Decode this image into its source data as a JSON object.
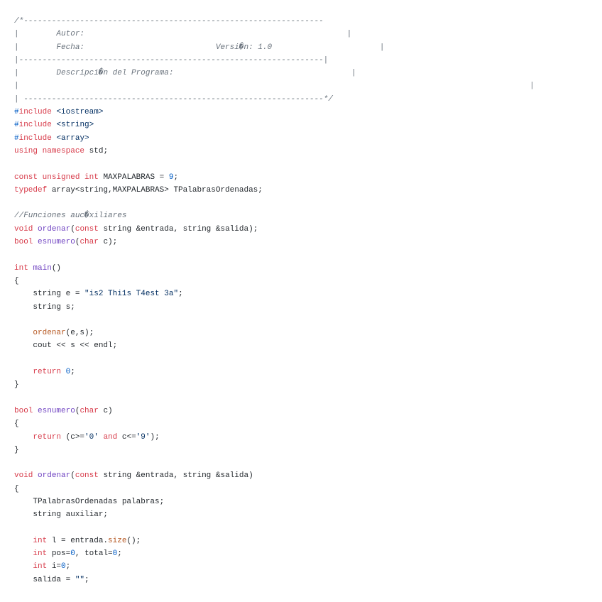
{
  "colors": {
    "keyword": "#d73a49",
    "function": "#6f42c1",
    "string": "#032f62",
    "number": "#005cc5",
    "comment": "#6a737d",
    "call": "#b5561f",
    "text": "#24292e"
  },
  "lines": [
    [
      [
        "/*----------------------------------------------------------------",
        "com"
      ]
    ],
    [
      [
        "|        Autor:                                                        |",
        "com"
      ]
    ],
    [
      [
        "|        Fecha:                            Versi�n: 1.0                       |",
        "com"
      ]
    ],
    [
      [
        "|-----------------------------------------------------------------|",
        "com"
      ]
    ],
    [
      [
        "|        Descripci�n del Programa:                                      |",
        "com"
      ]
    ],
    [
      [
        "|                                                                                                             |",
        "com"
      ]
    ],
    [
      [
        "| ----------------------------------------------------------------*/",
        "com"
      ]
    ],
    [
      [
        "#",
        "pp"
      ],
      [
        "include",
        "kw"
      ],
      [
        " ",
        "pl"
      ],
      [
        "<iostream>",
        "str"
      ]
    ],
    [
      [
        "#",
        "pp"
      ],
      [
        "include",
        "kw"
      ],
      [
        " ",
        "pl"
      ],
      [
        "<string>",
        "str"
      ]
    ],
    [
      [
        "#",
        "pp"
      ],
      [
        "include",
        "kw"
      ],
      [
        " ",
        "pl"
      ],
      [
        "<array>",
        "str"
      ]
    ],
    [
      [
        "using",
        "kw"
      ],
      [
        " ",
        "pl"
      ],
      [
        "namespace",
        "kw"
      ],
      [
        " std;",
        "pl"
      ]
    ],
    [],
    [
      [
        "const",
        "kw"
      ],
      [
        " ",
        "pl"
      ],
      [
        "unsigned",
        "kw"
      ],
      [
        " ",
        "pl"
      ],
      [
        "int",
        "kw"
      ],
      [
        " MAXPALABRAS = ",
        "pl"
      ],
      [
        "9",
        "num"
      ],
      [
        ";",
        "pl"
      ]
    ],
    [
      [
        "typedef",
        "kw"
      ],
      [
        " array<string,MAXPALABRAS> TPalabrasOrdenadas;",
        "pl"
      ]
    ],
    [],
    [
      [
        "//Funciones auc�xiliares",
        "com"
      ]
    ],
    [
      [
        "void",
        "kw"
      ],
      [
        " ",
        "pl"
      ],
      [
        "ordenar",
        "fn"
      ],
      [
        "(",
        "pl"
      ],
      [
        "const",
        "kw"
      ],
      [
        " string &entrada, string &salida);",
        "pl"
      ]
    ],
    [
      [
        "bool",
        "kw"
      ],
      [
        " ",
        "pl"
      ],
      [
        "esnumero",
        "fn"
      ],
      [
        "(",
        "pl"
      ],
      [
        "char",
        "kw"
      ],
      [
        " c);",
        "pl"
      ]
    ],
    [],
    [
      [
        "int",
        "kw"
      ],
      [
        " ",
        "pl"
      ],
      [
        "main",
        "fn"
      ],
      [
        "()",
        "pl"
      ]
    ],
    [
      [
        "{",
        "pl"
      ]
    ],
    [
      [
        "    string e = ",
        "pl"
      ],
      [
        "\"is2 Thi1s T4est 3a\"",
        "str"
      ],
      [
        ";",
        "pl"
      ]
    ],
    [
      [
        "    string s;",
        "pl"
      ]
    ],
    [],
    [
      [
        "    ",
        "pl"
      ],
      [
        "ordenar",
        "call"
      ],
      [
        "(e,s);",
        "pl"
      ]
    ],
    [
      [
        "    cout << s << endl;",
        "pl"
      ]
    ],
    [],
    [
      [
        "    ",
        "pl"
      ],
      [
        "return",
        "kw"
      ],
      [
        " ",
        "pl"
      ],
      [
        "0",
        "num"
      ],
      [
        ";",
        "pl"
      ]
    ],
    [
      [
        "}",
        "pl"
      ]
    ],
    [],
    [
      [
        "bool",
        "kw"
      ],
      [
        " ",
        "pl"
      ],
      [
        "esnumero",
        "fn"
      ],
      [
        "(",
        "pl"
      ],
      [
        "char",
        "kw"
      ],
      [
        " c)",
        "pl"
      ]
    ],
    [
      [
        "{",
        "pl"
      ]
    ],
    [
      [
        "    ",
        "pl"
      ],
      [
        "return",
        "kw"
      ],
      [
        " (c>=",
        "pl"
      ],
      [
        "'0'",
        "str"
      ],
      [
        " ",
        "pl"
      ],
      [
        "and",
        "kw"
      ],
      [
        " c<=",
        "pl"
      ],
      [
        "'9'",
        "str"
      ],
      [
        ");",
        "pl"
      ]
    ],
    [
      [
        "}",
        "pl"
      ]
    ],
    [],
    [
      [
        "void",
        "kw"
      ],
      [
        " ",
        "pl"
      ],
      [
        "ordenar",
        "fn"
      ],
      [
        "(",
        "pl"
      ],
      [
        "const",
        "kw"
      ],
      [
        " string &entrada, string &salida)",
        "pl"
      ]
    ],
    [
      [
        "{",
        "pl"
      ]
    ],
    [
      [
        "    TPalabrasOrdenadas palabras;",
        "pl"
      ]
    ],
    [
      [
        "    string auxiliar;",
        "pl"
      ]
    ],
    [],
    [
      [
        "    ",
        "pl"
      ],
      [
        "int",
        "kw"
      ],
      [
        " l = entrada.",
        "pl"
      ],
      [
        "size",
        "call"
      ],
      [
        "();",
        "pl"
      ]
    ],
    [
      [
        "    ",
        "pl"
      ],
      [
        "int",
        "kw"
      ],
      [
        " pos=",
        "pl"
      ],
      [
        "0",
        "num"
      ],
      [
        ", total=",
        "pl"
      ],
      [
        "0",
        "num"
      ],
      [
        ";",
        "pl"
      ]
    ],
    [
      [
        "    ",
        "pl"
      ],
      [
        "int",
        "kw"
      ],
      [
        " i=",
        "pl"
      ],
      [
        "0",
        "num"
      ],
      [
        ";",
        "pl"
      ]
    ],
    [
      [
        "    salida = ",
        "pl"
      ],
      [
        "\"\"",
        "str"
      ],
      [
        ";",
        "pl"
      ]
    ]
  ]
}
